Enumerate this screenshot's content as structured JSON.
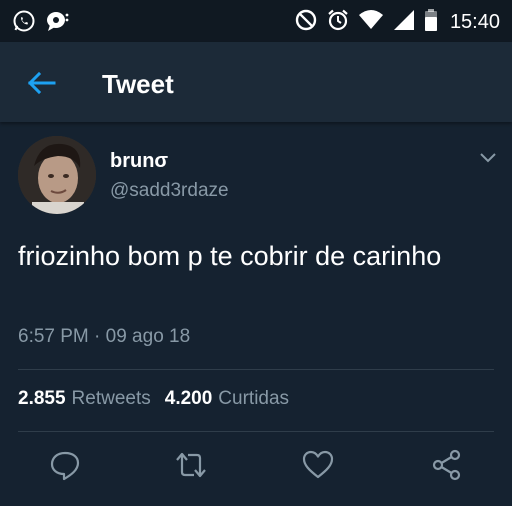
{
  "status_bar": {
    "time": "15:40",
    "left_icons": [
      "whatsapp-icon",
      "message-bubble-icon"
    ],
    "right_icons": [
      "do-not-disturb-icon",
      "alarm-icon",
      "wifi-icon",
      "signal-icon",
      "battery-icon"
    ]
  },
  "app_bar": {
    "title": "Tweet",
    "back_icon": "back-arrow-icon"
  },
  "tweet": {
    "author_name": "brunσ",
    "author_handle": "@sadd3rdaze",
    "text": "friozinho bom p te cobrir de carinho",
    "timestamp": "6:57 PM · 09 ago 18"
  },
  "stats": {
    "retweets_count": "2.855",
    "retweets_label": "Retweets",
    "likes_count": "4.200",
    "likes_label": "Curtidas"
  },
  "actions": [
    "reply-icon",
    "retweet-icon",
    "like-icon",
    "share-icon"
  ],
  "colors": {
    "background": "#152230",
    "app_bar": "#1c2a38",
    "accent": "#1da1f2",
    "muted_text": "#8899a6"
  }
}
